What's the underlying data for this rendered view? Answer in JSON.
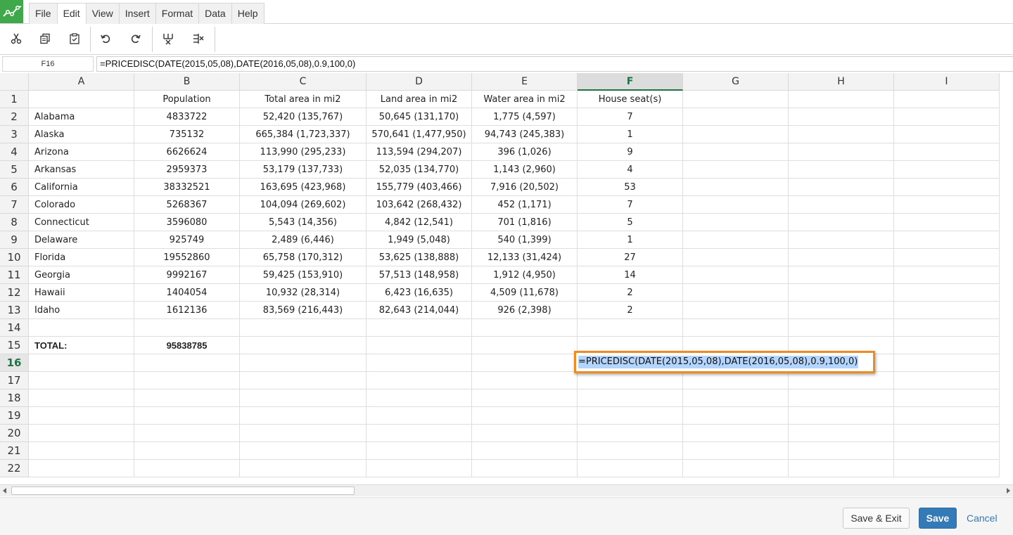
{
  "menu": {
    "tabs": [
      {
        "label": "File"
      },
      {
        "label": "Edit",
        "active": true
      },
      {
        "label": "View"
      },
      {
        "label": "Insert"
      },
      {
        "label": "Format"
      },
      {
        "label": "Data"
      },
      {
        "label": "Help"
      }
    ]
  },
  "toolbar": {
    "buttons": [
      "cut-icon",
      "copy-icon",
      "paste-icon",
      "undo-icon",
      "redo-icon",
      "insert-column-icon",
      "delete-column-icon"
    ]
  },
  "formula_bar": {
    "cell_ref": "F16",
    "formula": "=PRICEDISC(DATE(2015,05,08),DATE(2016,05,08),0.9,100,0)"
  },
  "grid": {
    "columns": [
      "A",
      "B",
      "C",
      "D",
      "E",
      "F",
      "G",
      "H",
      "I"
    ],
    "selected_column": "F",
    "selected_row": 16,
    "row_numbers": [
      1,
      2,
      3,
      4,
      5,
      6,
      7,
      8,
      9,
      10,
      11,
      12,
      13,
      14,
      15,
      16,
      17,
      18,
      19,
      20,
      21,
      22
    ],
    "headers": [
      "",
      "Population",
      "Total area in mi2",
      "Land area in mi2",
      "Water area in mi2",
      "House seat(s)"
    ],
    "rows": [
      [
        "Alabama",
        "4833722",
        "52,420 (135,767)",
        "50,645 (131,170)",
        "1,775 (4,597)",
        "7"
      ],
      [
        "Alaska",
        "735132",
        "665,384 (1,723,337)",
        "570,641 (1,477,950)",
        "94,743 (245,383)",
        "1"
      ],
      [
        "Arizona",
        "6626624",
        "113,990 (295,233)",
        "113,594 (294,207)",
        "396 (1,026)",
        "9"
      ],
      [
        "Arkansas",
        "2959373",
        "53,179 (137,733)",
        "52,035 (134,770)",
        "1,143 (2,960)",
        "4"
      ],
      [
        "California",
        "38332521",
        "163,695 (423,968)",
        "155,779 (403,466)",
        "7,916 (20,502)",
        "53"
      ],
      [
        "Colorado",
        "5268367",
        "104,094 (269,602)",
        "103,642 (268,432)",
        "452 (1,171)",
        "7"
      ],
      [
        "Connecticut",
        "3596080",
        "5,543 (14,356)",
        "4,842 (12,541)",
        "701 (1,816)",
        "5"
      ],
      [
        "Delaware",
        "925749",
        "2,489 (6,446)",
        "1,949 (5,048)",
        "540 (1,399)",
        "1"
      ],
      [
        "Florida",
        "19552860",
        "65,758 (170,312)",
        "53,625 (138,888)",
        "12,133 (31,424)",
        "27"
      ],
      [
        "Georgia",
        "9992167",
        "59,425 (153,910)",
        "57,513 (148,958)",
        "1,912 (4,950)",
        "14"
      ],
      [
        "Hawaii",
        "1404054",
        "10,932 (28,314)",
        "6,423 (16,635)",
        "4,509 (11,678)",
        "2"
      ],
      [
        "Idaho",
        "1612136",
        "83,569 (216,443)",
        "82,643 (214,044)",
        "926 (2,398)",
        "2"
      ]
    ],
    "total_label": "TOTAL:",
    "total_value": "95838785"
  },
  "editor": {
    "text": "=PRICEDISC(DATE(2015,05,08),DATE(2016,05,08),0.9,100,0)"
  },
  "footer": {
    "save_exit_label": "Save & Exit",
    "save_label": "Save",
    "cancel_label": "Cancel"
  },
  "colors": {
    "accent_green": "#217346",
    "logo_green": "#3ea84a",
    "edit_border": "#f08c1e",
    "save_blue": "#337ab7",
    "selection_blue": "#b4d5fe"
  }
}
